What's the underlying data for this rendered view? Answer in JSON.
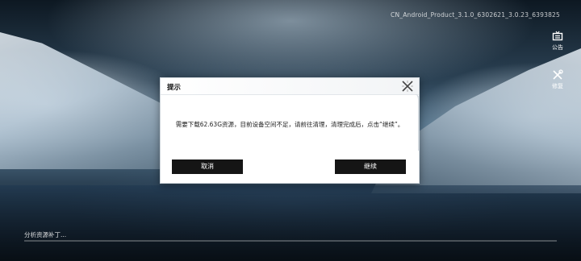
{
  "build": {
    "version": "CN_Android_Product_3.1.0_6302621_3.0.23_6393825"
  },
  "side_menu": {
    "notice_label": "公告",
    "repair_label": "修复"
  },
  "dialog": {
    "title": "提示",
    "message": "需要下载62.63G资源，目前设备空间不足，请前往清理，清理完成后，点击“继续”。",
    "cancel_label": "取消",
    "continue_label": "继续"
  },
  "status": {
    "text": "分析资源补丁...",
    "progress": 0
  },
  "icons": {
    "notice": "notice-icon",
    "repair": "repair-icon",
    "close": "close-icon"
  }
}
